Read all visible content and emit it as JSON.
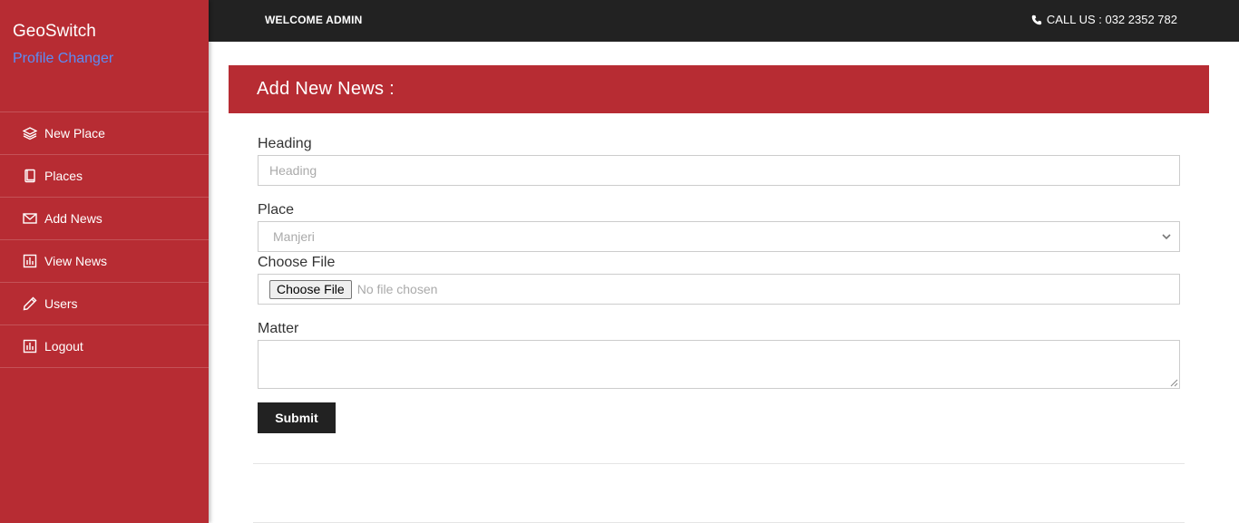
{
  "sidebar": {
    "brand_title": "GeoSwitch",
    "brand_subtitle": "Profile Changer",
    "items": [
      {
        "label": "New Place",
        "icon": "layers-icon"
      },
      {
        "label": "Places",
        "icon": "book-icon"
      },
      {
        "label": "Add News",
        "icon": "envelope-icon"
      },
      {
        "label": "View News",
        "icon": "bar-chart-icon"
      },
      {
        "label": "Users",
        "icon": "pencil-icon"
      },
      {
        "label": "Logout",
        "icon": "bar-chart-icon"
      }
    ]
  },
  "topbar": {
    "welcome": "WELCOME ADMIN",
    "call": "CALL US : 032 2352 782"
  },
  "panel": {
    "title": "Add New News :"
  },
  "form": {
    "heading_label": "Heading",
    "heading_placeholder": "Heading",
    "place_label": "Place",
    "place_selected": "Manjeri",
    "file_label": "Choose File",
    "file_button": "Choose File",
    "file_status": "No file chosen",
    "matter_label": "Matter",
    "submit_label": "Submit"
  },
  "colors": {
    "accent": "#b72c33",
    "dark": "#222222",
    "link": "#5b8cf5"
  }
}
